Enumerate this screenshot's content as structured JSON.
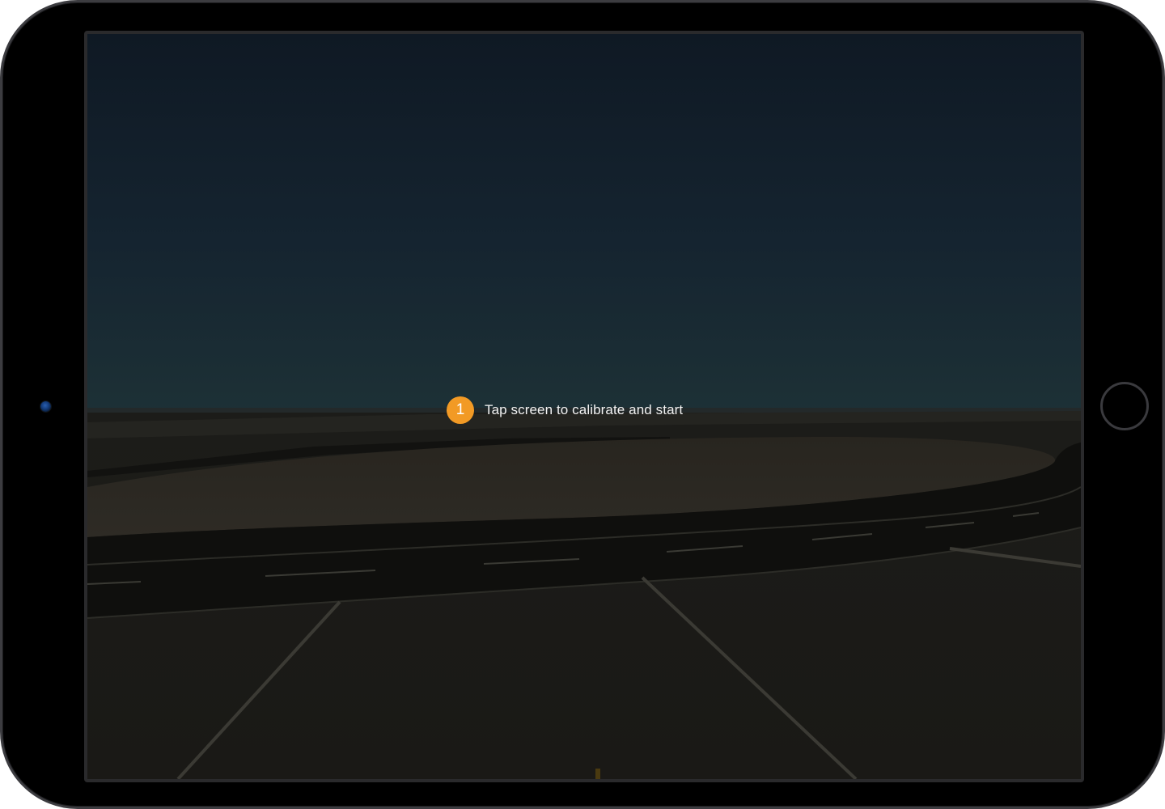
{
  "device": {
    "camera_icon": "front-camera-icon",
    "home_icon": "home-button-icon"
  },
  "screen": {
    "scene": "3d-airport-runway-dusk",
    "prompt": {
      "step_number": "1",
      "text": "Tap screen to calibrate and start",
      "badge_color": "#f29a25"
    }
  },
  "colors": {
    "sky_top": "#101a26",
    "sky_horizon": "#1c3036",
    "ground": "#1f1e1b",
    "runway": "#0f0f0d"
  }
}
